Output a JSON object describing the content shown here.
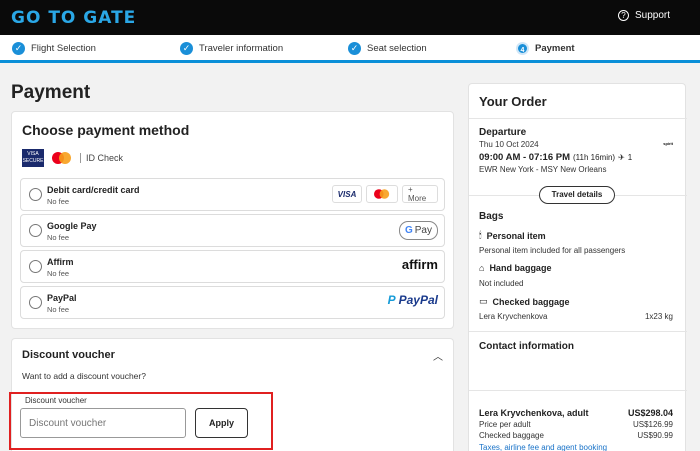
{
  "header": {
    "logo": "GO TO GATE",
    "support_label": "Support"
  },
  "steps": [
    {
      "label": "Flight Selection",
      "state": "done"
    },
    {
      "label": "Traveler information",
      "state": "done"
    },
    {
      "label": "Seat selection",
      "state": "done"
    },
    {
      "label": "Payment",
      "state": "active",
      "number": "4"
    }
  ],
  "page_title": "Payment",
  "payment": {
    "title": "Choose payment method",
    "visa_badge": "VISA",
    "visa_badge_sub": "SECURE",
    "id_check": "ID Check",
    "options": [
      {
        "name": "Debit card/credit card",
        "fee": "No fee",
        "brand_visa": "VISA",
        "more_label": "+ More"
      },
      {
        "name": "Google Pay",
        "fee": "No fee",
        "brand_g": "G",
        "brand_text": "Pay"
      },
      {
        "name": "Affirm",
        "fee": "No fee",
        "brand_text": "affirm"
      },
      {
        "name": "PayPal",
        "fee": "No fee",
        "brand_p": "P",
        "brand_text": "PayPal"
      }
    ]
  },
  "voucher": {
    "title": "Discount voucher",
    "hint": "Want to add a discount voucher?",
    "field_label": "Discount voucher",
    "placeholder": "Discount voucher",
    "apply_label": "Apply"
  },
  "order": {
    "title": "Your Order",
    "departure_label": "Departure",
    "date": "Thu 10 Oct 2024",
    "airline": "spirit",
    "time": "09:00 AM - 07:16 PM",
    "duration": "(11h 16min)",
    "stops": "1",
    "route": "EWR New York - MSY New Orleans",
    "travel_details_label": "Travel details",
    "bags_label": "Bags",
    "personal_item_label": "Personal item",
    "personal_item_note": "Personal item included for all passengers",
    "hand_baggage_label": "Hand baggage",
    "hand_baggage_note": "Not included",
    "checked_baggage_label": "Checked baggage",
    "checked_passenger": "Lera Kryvchenkova",
    "checked_qty": "1x23 kg",
    "contact_label": "Contact information",
    "price_passenger": "Lera Kryvchenkova, adult",
    "price_total": "US$298.04",
    "price_per_adult_label": "Price per adult",
    "price_per_adult": "US$126.99",
    "checked_baggage_price_label": "Checked baggage",
    "checked_baggage_price": "US$90.99",
    "fees_link": "Taxes, airline fee and agent booking"
  }
}
